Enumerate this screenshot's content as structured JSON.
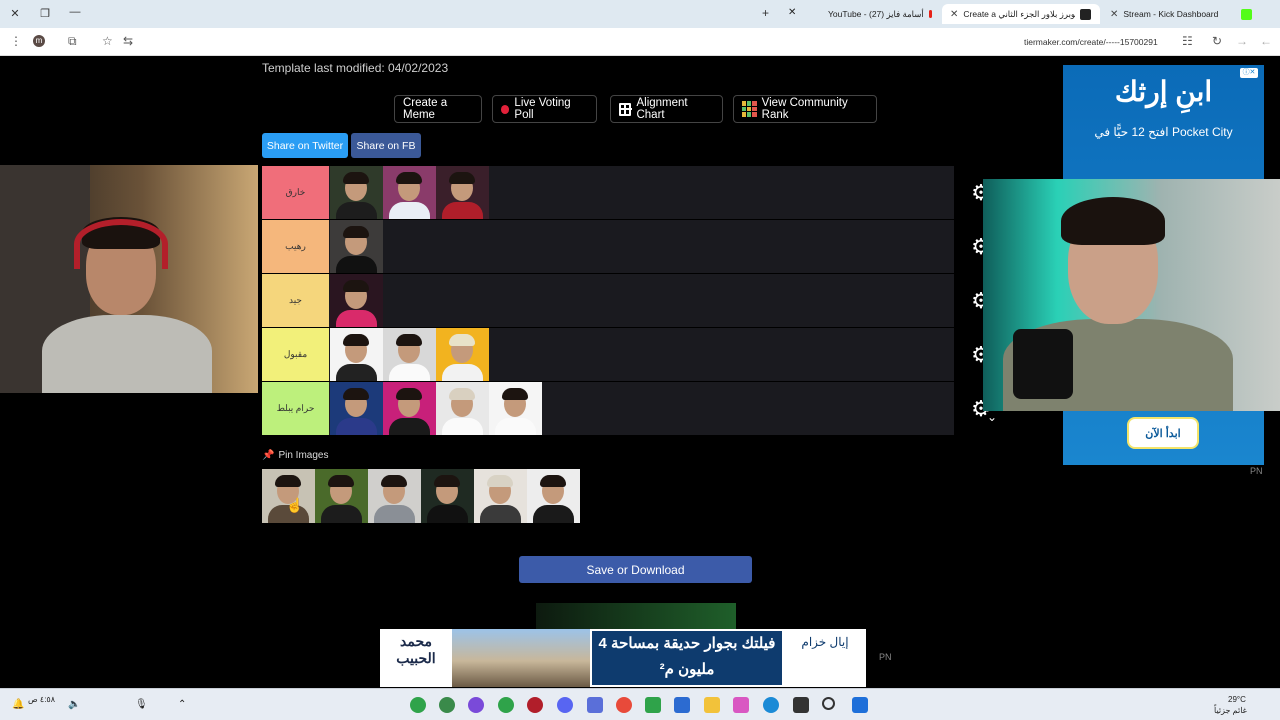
{
  "browser": {
    "tabs": [
      {
        "label": "YouTube - أسامة فايز (27)",
        "icon": "youtube-icon"
      },
      {
        "label": "Create a تير ليست يوتيوبرز بلاور الجزء الثاني",
        "icon": "tiermaker-icon",
        "active": true
      },
      {
        "label": "Stream - Kick Dashboard",
        "icon": "kick-icon"
      }
    ],
    "url": "tiermaker.com/create/-----15700291"
  },
  "page": {
    "modified": "Template last modified: 04/02/2023",
    "buttons": {
      "meme": "Create a Meme",
      "poll": "Live Voting Poll",
      "alignment": "Alignment Chart",
      "community": "View Community Rank"
    },
    "share": {
      "twitter": "Share on Twitter",
      "fb": "Share on FB"
    },
    "tiers": [
      {
        "label": "خارق",
        "color": "#f06e7a",
        "count": 3
      },
      {
        "label": "رهيب",
        "color": "#f5b77c",
        "count": 1
      },
      {
        "label": "جيد",
        "color": "#f5d67c",
        "count": 1
      },
      {
        "label": "مقبول",
        "color": "#f2f07a",
        "count": 3
      },
      {
        "label": "حرام يبلط",
        "color": "#bdf07c",
        "count": 4
      }
    ],
    "pin_label": "Pin Images",
    "pin_count": 6,
    "save": "Save or Download"
  },
  "ads": {
    "right_title": "ابنِ إرثك",
    "right_sub": "افتح 12 حيًّا في Pocket City",
    "right_btn": "ابدأ الآن",
    "bottom_brand": "محمد الحبيب",
    "bottom_text": "فيلتك بجوار حديقة بمساحة 4 مليون م²",
    "bottom_brand2": "إيال خزام",
    "pn": "PN"
  },
  "taskbar": {
    "weather": "29°C",
    "weather_sub": "غائم جزئياً",
    "clock": "٤:٥٨ ص"
  }
}
